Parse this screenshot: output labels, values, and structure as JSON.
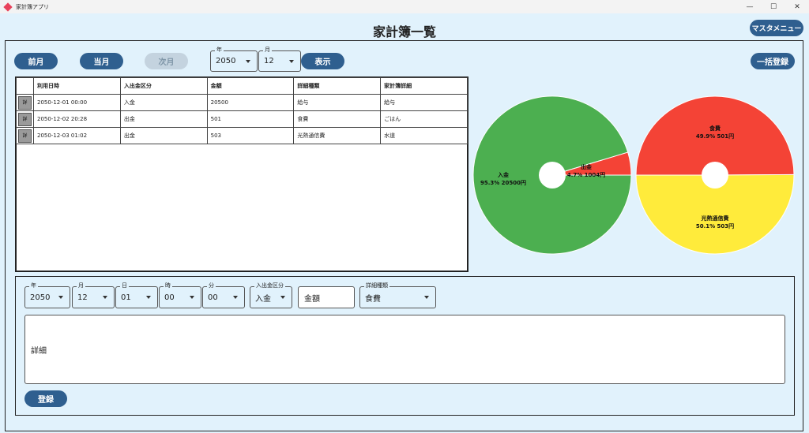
{
  "window": {
    "title": "家計簿アプリ",
    "controls": [
      "—",
      "☐",
      "✕"
    ]
  },
  "header": {
    "title": "家計簿一覧",
    "master_menu": "マスタメニュー"
  },
  "toolbar": {
    "prev_month": "前月",
    "this_month": "当月",
    "next_month": "次月",
    "year_label": "年",
    "year_value": "2050",
    "month_label": "月",
    "month_value": "12",
    "show": "表示",
    "bulk_register": "一括登録"
  },
  "table": {
    "columns": [
      "",
      "利用日時",
      "入出金区分",
      "金額",
      "詳細種類",
      "家計簿詳細"
    ],
    "detail_button": "詳",
    "rows": [
      [
        "2050-12-01 00:00",
        "入金",
        "20500",
        "給与",
        "給与"
      ],
      [
        "2050-12-02 20:28",
        "出金",
        "501",
        "食費",
        "ごはん"
      ],
      [
        "2050-12-03 01:02",
        "出金",
        "503",
        "光熱通信費",
        "水道"
      ]
    ]
  },
  "chart_data": [
    {
      "type": "pie",
      "categories": [
        "入金",
        "出金"
      ],
      "values": [
        20500,
        1004
      ],
      "labels": [
        "95.3% 20500円",
        "4.7% 1004円"
      ],
      "colors": [
        "#4caf50",
        "#f44336"
      ]
    },
    {
      "type": "pie",
      "categories": [
        "食費",
        "光熱通信費"
      ],
      "values": [
        501,
        503
      ],
      "labels": [
        "49.9% 501円",
        "50.1% 503円"
      ],
      "colors": [
        "#f44336",
        "#ffeb3b"
      ]
    }
  ],
  "form": {
    "year_label": "年",
    "year_value": "2050",
    "month_label": "月",
    "month_value": "12",
    "day_label": "日",
    "day_value": "01",
    "hour_label": "時",
    "hour_value": "00",
    "minute_label": "分",
    "minute_value": "00",
    "io_label": "入出金区分",
    "io_value": "入金",
    "amount_placeholder": "金額",
    "detail_type_label": "詳細種類",
    "detail_type_value": "食費",
    "detail_placeholder": "詳細",
    "register": "登録"
  }
}
